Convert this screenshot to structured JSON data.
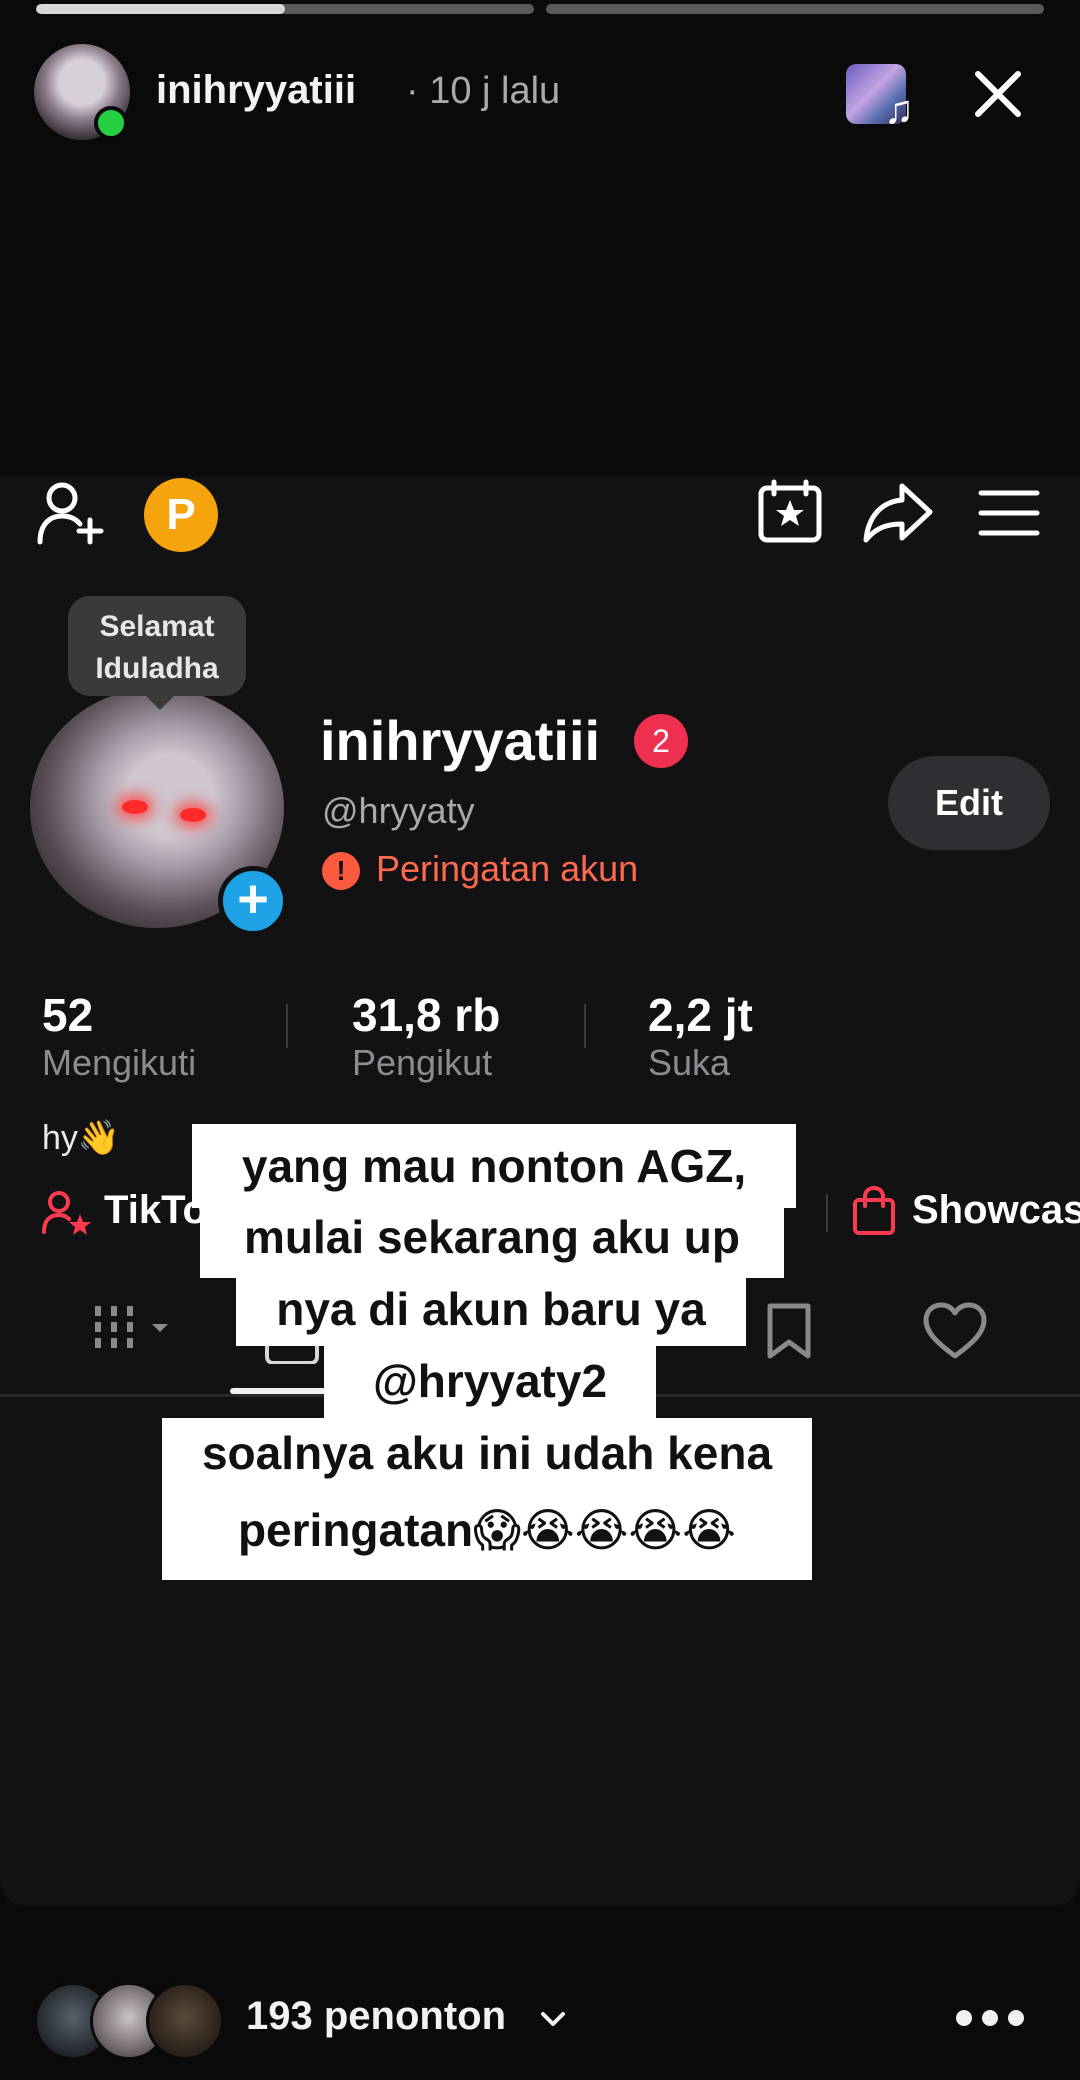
{
  "story": {
    "progress": [
      0.5,
      0
    ],
    "username": "inihryyatiii",
    "time": "· 10 j lalu"
  },
  "profile": {
    "tooltip_line1": "Selamat",
    "tooltip_line2": "Iduladha",
    "display_name": "inihryyatiii",
    "notification_count": "2",
    "handle": "@hryyaty",
    "warning": "Peringatan akun",
    "edit_label": "Edit",
    "points_badge": "P",
    "stats": [
      {
        "value": "52",
        "label": "Mengikuti"
      },
      {
        "value": "31,8 rb",
        "label": "Pengikut"
      },
      {
        "value": "2,2 jt",
        "label": "Suka"
      }
    ],
    "bio": "hy👋",
    "link_left": "TikTo",
    "link_right": "Showcas"
  },
  "caption": {
    "lines": [
      "yang mau nonton AGZ,",
      "mulai sekarang aku up",
      "nya di akun baru ya",
      "@hryyaty2",
      "soalnya aku ini udah kena",
      "peringatan😱😭😭😭😭"
    ]
  },
  "footer": {
    "viewers": "193 penonton"
  },
  "icons": [
    "online-dot",
    "music-icon",
    "close-icon",
    "add-friend-icon",
    "calendar-star-icon",
    "share-icon",
    "menu-icon",
    "warning-icon",
    "add-icon",
    "grid-icon",
    "repost-icon",
    "bookmark-icon",
    "heart-icon",
    "shopping-bag-icon",
    "chevron-down-icon",
    "more-icon"
  ],
  "colors": {
    "accent_warning": "#fe6a50",
    "badge_red": "#ee2f4f",
    "online": "#25d044",
    "points": "#f5a40e",
    "add_blue": "#1ea4e6"
  }
}
